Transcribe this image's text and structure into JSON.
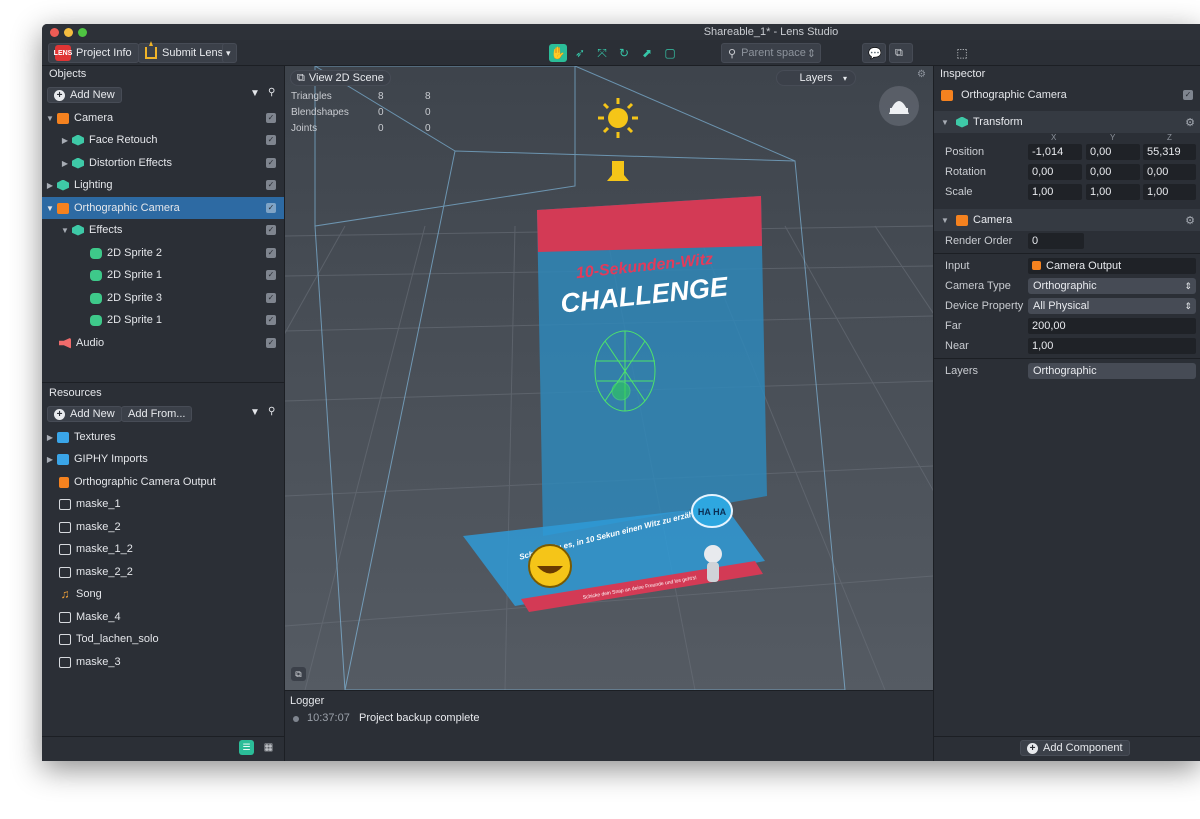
{
  "window": {
    "title": "Shareable_1* - Lens Studio"
  },
  "toolbar": {
    "project_info_label": "Project Info",
    "project_badge": "LENS",
    "submit_lens_label": "Submit Lens",
    "parent_space_placeholder": "Parent space",
    "tools": [
      "hand-tool",
      "move-tool",
      "scale-tool",
      "rotate-tool",
      "transform-tool",
      "rect-tool"
    ]
  },
  "objects": {
    "title": "Objects",
    "add_new_label": "Add New",
    "items": [
      {
        "label": "Camera",
        "icon": "camera-icon"
      },
      {
        "label": "Face Retouch",
        "icon": "effect-icon"
      },
      {
        "label": "Distortion Effects",
        "icon": "effect-icon"
      },
      {
        "label": "Lighting",
        "icon": "effect-icon"
      },
      {
        "label": "Orthographic Camera",
        "icon": "camera-icon"
      },
      {
        "label": "Effects",
        "icon": "effect-icon"
      },
      {
        "label": "2D Sprite 2",
        "icon": "sprite-icon"
      },
      {
        "label": "2D Sprite 1",
        "icon": "sprite-icon"
      },
      {
        "label": "2D Sprite 3",
        "icon": "sprite-icon"
      },
      {
        "label": "2D Sprite 1",
        "icon": "sprite-icon"
      },
      {
        "label": "Audio",
        "icon": "audio-icon"
      }
    ]
  },
  "resources": {
    "title": "Resources",
    "add_new_label": "Add New",
    "add_from_label": "Add From...",
    "items": [
      {
        "label": "Textures",
        "icon": "folder-icon"
      },
      {
        "label": "GIPHY Imports",
        "icon": "folder-icon"
      },
      {
        "label": "Orthographic Camera Output",
        "icon": "render-target-icon"
      },
      {
        "label": "maske_1",
        "icon": "image-icon"
      },
      {
        "label": "maske_2",
        "icon": "image-icon"
      },
      {
        "label": "maske_1_2",
        "icon": "image-icon"
      },
      {
        "label": "maske_2_2",
        "icon": "image-icon"
      },
      {
        "label": "Song",
        "icon": "music-icon"
      },
      {
        "label": "Maske_4",
        "icon": "image-icon"
      },
      {
        "label": "Tod_lachen_solo",
        "icon": "image-icon"
      },
      {
        "label": "maske_3",
        "icon": "image-icon"
      }
    ]
  },
  "viewport": {
    "view_2d_label": "View 2D Scene",
    "layers_label": "Layers",
    "stats": [
      {
        "label": "Triangles",
        "a": "8",
        "b": "8"
      },
      {
        "label": "Blendshapes",
        "a": "0",
        "b": "0"
      },
      {
        "label": "Joints",
        "a": "0",
        "b": "0"
      }
    ],
    "poster_line1": "10-Sekunden-Witz",
    "poster_line2": "CHALLENGE",
    "poster_text": "Schaffst du es, in 10 Sekun einen Witz zu erzählen?",
    "poster_footer": "Schicke dein Snap an deine Freunde und los geht's!",
    "bubble_text": "HA HA"
  },
  "logger": {
    "title": "Logger",
    "entries": [
      {
        "time": "10:37:07",
        "message": "Project backup complete"
      }
    ]
  },
  "inspector": {
    "title": "Inspector",
    "object_name": "Orthographic Camera",
    "transform": {
      "title": "Transform",
      "axes": [
        "X",
        "Y",
        "Z"
      ],
      "position_label": "Position",
      "rotation_label": "Rotation",
      "scale_label": "Scale",
      "position": [
        "-1,014",
        "0,00",
        "55,319"
      ],
      "rotation": [
        "0,00",
        "0,00",
        "0,00"
      ],
      "scale": [
        "1,00",
        "1,00",
        "1,00"
      ]
    },
    "camera": {
      "title": "Camera",
      "render_order_label": "Render Order",
      "render_order": "0",
      "input_label": "Input",
      "input_value": "Camera Output",
      "camera_type_label": "Camera Type",
      "camera_type": "Orthographic",
      "device_property_label": "Device Property",
      "device_property": "All Physical",
      "far_label": "Far",
      "far": "200,00",
      "near_label": "Near",
      "near": "1,00",
      "layers_label": "Layers",
      "layers_value": "Orthographic"
    },
    "add_component_label": "Add Component"
  }
}
